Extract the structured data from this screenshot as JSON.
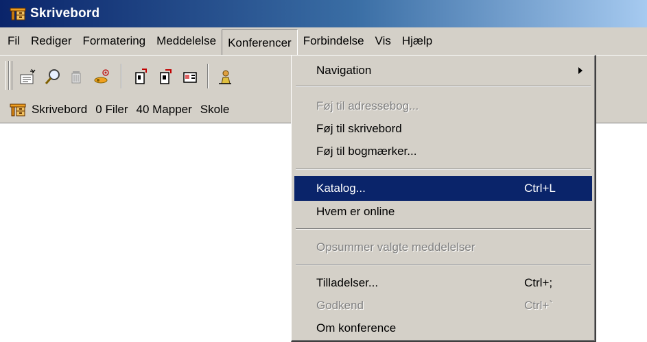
{
  "window": {
    "title": "Skrivebord",
    "app_icon": "desk-icon"
  },
  "menubar": {
    "items": [
      {
        "label": "Fil"
      },
      {
        "label": "Rediger"
      },
      {
        "label": "Formatering"
      },
      {
        "label": "Meddelelse"
      },
      {
        "label": "Konferencer",
        "open": true
      },
      {
        "label": "Forbindelse"
      },
      {
        "label": "Vis"
      },
      {
        "label": "Hjælp"
      }
    ]
  },
  "toolbar": {
    "buttons": [
      {
        "icon": "new-message-icon"
      },
      {
        "icon": "search-icon"
      },
      {
        "icon": "trash-icon"
      },
      {
        "icon": "keys-icon"
      },
      {
        "icon": "exit-door-icon"
      },
      {
        "icon": "door-open-icon"
      },
      {
        "icon": "card-icon"
      },
      {
        "icon": "person-icon"
      }
    ]
  },
  "addressbar": {
    "location": "Skrivebord",
    "files": "0 Filer",
    "folders": "40 Mapper",
    "extra": "Skole"
  },
  "dropdown": {
    "items": [
      {
        "label": "Navigation",
        "submenu": true
      },
      {
        "label": "Føj til adressebog..."
      },
      {
        "label": "Føj til skrivebord"
      },
      {
        "label": "Føj til bogmærker..."
      },
      {
        "label": "Katalog...",
        "shortcut": "Ctrl+L",
        "highlighted": true
      },
      {
        "label": "Hvem er online"
      },
      {
        "label": "Opsummer valgte meddelelser"
      },
      {
        "label": "Tilladelser...",
        "shortcut": "Ctrl+;"
      },
      {
        "label": "Godkend",
        "shortcut": "Ctrl+`"
      },
      {
        "label": "Om konference"
      }
    ]
  }
}
